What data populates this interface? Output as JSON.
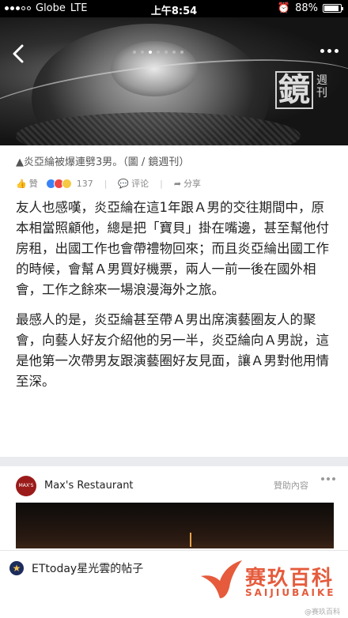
{
  "status_bar": {
    "carrier": "Globe",
    "network": "LTE",
    "time": "上午8:54",
    "battery": "88%",
    "battery_level": 0.88
  },
  "header": {
    "back_icon": "chevron-left-icon",
    "more_icon": "ellipsis-icon",
    "page_dots": 7,
    "active_dot": 2
  },
  "hero": {
    "watermark_big": "鏡",
    "watermark_small": "週刊"
  },
  "article": {
    "caption": "▲炎亞綸被爆連劈3男。（圖 / 鏡週刊）",
    "like_label": "贊",
    "reaction_count": "137",
    "comment_label": "评论",
    "share_label": "分享",
    "paragraphs": [
      "友人也感嘆，炎亞綸在這1年跟Ａ男的交往期間中，原本相當照顧他，總是把「寶貝」掛在嘴邊，甚至幫他付房租，出國工作也會帶禮物回來；而且炎亞綸出國工作的時候，會幫Ａ男買好機票，兩人一前一後在國外相會，工作之餘來一場浪漫海外之旅。",
      "最感人的是，炎亞綸甚至帶Ａ男出席演藝圈友人的聚會，向藝人好友介紹他的另一半，炎亞綸向Ａ男說，這是他第一次帶男友跟演藝圈好友見面，讓Ａ男對他用情至深。"
    ]
  },
  "sponsor": {
    "logo_text": "MAX'S",
    "name": "Max's Restaurant",
    "tag": "贊助內容"
  },
  "bottom": {
    "post_label": "ETtoday星光雲的帖子",
    "brand_cn": "赛玖百科",
    "brand_en": "SAIJIUBAIKE",
    "credit": "@赛玖百科"
  },
  "colors": {
    "brand": "#e55b3c",
    "like_blue": "#3b5998"
  }
}
